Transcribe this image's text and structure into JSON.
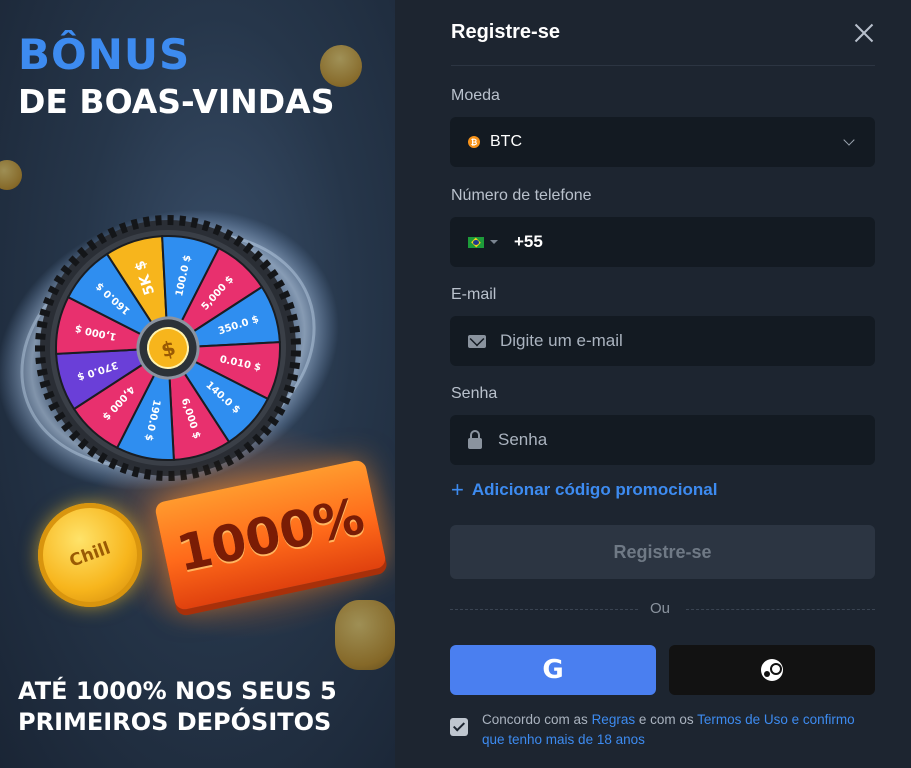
{
  "promo": {
    "title_line1": "BÔNUS",
    "title_line2": "DE BOAS-VINDAS",
    "badge": "1000%",
    "coin_label": "Chill",
    "bottom_text": "ATÉ 1000% NOS SEUS 5 PRIMEIROS DEPÓSITOS",
    "wheel_segments": [
      "5K $",
      "100.0 $",
      "5,000 $",
      "350.0 $",
      "0.010 $",
      "140.0 $",
      "6,000 $",
      "190.0 $",
      "4,000 $",
      "370.0 $",
      "1,000 $",
      "160.0 $"
    ]
  },
  "form": {
    "title": "Registre-se",
    "currency": {
      "label": "Moeda",
      "value": "BTC"
    },
    "phone": {
      "label": "Número de telefone",
      "code": "+55"
    },
    "email": {
      "label": "E-mail",
      "placeholder": "Digite um e-mail"
    },
    "password": {
      "label": "Senha",
      "placeholder": "Senha"
    },
    "promo_code_link": "Adicionar código promocional",
    "submit_label": "Registre-se",
    "or_text": "Ou",
    "terms": {
      "prefix": "Concordo com as ",
      "rules_link": "Regras",
      "middle": " e com os ",
      "terms_link": "Termos de Uso e confirmo que tenho mais de 18 anos"
    }
  },
  "colors": {
    "accent": "#3d8bf0",
    "google_button": "#4a7ff0",
    "steam_button": "#121212",
    "panel": "#1d2530",
    "input": "#131a22",
    "badge_orange": "#ff6a1a"
  },
  "icons": [
    "close-icon",
    "chevron-down-icon",
    "btc-icon",
    "brazil-flag-icon",
    "mail-icon",
    "lock-icon",
    "plus-icon",
    "google-icon",
    "steam-icon",
    "check-icon"
  ]
}
